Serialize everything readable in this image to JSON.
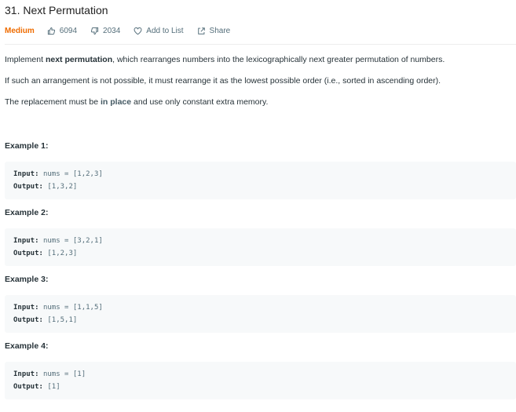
{
  "problem": {
    "title": "31. Next Permutation",
    "difficulty": "Medium",
    "likes": "6094",
    "dislikes": "2034",
    "add_to_list": "Add to List",
    "share": "Share"
  },
  "description": {
    "p1_before": "Implement ",
    "p1_bold": "next permutation",
    "p1_after": ", which rearranges numbers into the lexicographically next greater permutation of numbers.",
    "p2": "If such an arrangement is not possible, it must rearrange it as the lowest possible order (i.e., sorted in ascending order).",
    "p3_before": "The replacement must be ",
    "p3_bold": "in place",
    "p3_after": " and use only constant extra memory."
  },
  "examples": [
    {
      "title": "Example 1:",
      "input_label": "Input:",
      "input": "nums = [1,2,3]",
      "output_label": "Output:",
      "output": "[1,3,2]"
    },
    {
      "title": "Example 2:",
      "input_label": "Input:",
      "input": "nums = [3,2,1]",
      "output_label": "Output:",
      "output": "[1,2,3]"
    },
    {
      "title": "Example 3:",
      "input_label": "Input:",
      "input": "nums = [1,1,5]",
      "output_label": "Output:",
      "output": "[1,5,1]"
    },
    {
      "title": "Example 4:",
      "input_label": "Input:",
      "input": "nums = [1]",
      "output_label": "Output:",
      "output": "[1]"
    }
  ],
  "colors": {
    "difficulty_medium": "#ef6c00",
    "text": "#263238",
    "muted": "#546e7a",
    "code_bg": "#f7f9fa"
  },
  "icons": {
    "like": "thumbs-up-icon",
    "dislike": "thumbs-down-icon",
    "list": "heart-icon",
    "share": "share-icon"
  }
}
